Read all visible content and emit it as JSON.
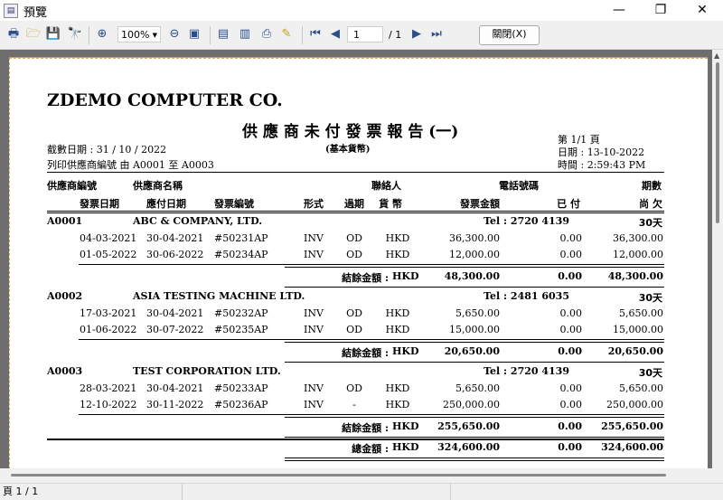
{
  "window": {
    "title": "預覽"
  },
  "toolbar": {
    "zoom": "100%",
    "page_current": "1",
    "page_total": "/ 1",
    "close_label": "關閉(X)"
  },
  "report": {
    "company": "ZDEMO COMPUTER CO.",
    "title": "供 應 商 未 付 發 票 報 告 (一)",
    "subtitle": "(基本貨幣)",
    "cutoff_date": "截數日期 :  31 / 10 / 2022",
    "range": "列印供應商編號 由    A0001  至   A0003",
    "page": "第 1/1 頁",
    "print_date": "日期 : 13-10-2022",
    "print_time": "時間 : 2:59:43 PM",
    "col": {
      "supplier_code": "供應商編號",
      "supplier_name": "供應商名稱",
      "contact": "聯絡人",
      "phone": "電話號碼",
      "terms": "期數",
      "inv_date": "發票日期",
      "due_date": "應付日期",
      "inv_no": "發票編號",
      "type": "形式",
      "overdue": "過期",
      "currency": "貨 幣",
      "amount": "發票金額",
      "paid": "已  付",
      "balance": "尚  欠"
    },
    "suppliers": [
      {
        "code": "A0001",
        "name": "ABC & COMPANY, LTD.",
        "tel": "Tel : 2720 4139",
        "terms": "30天",
        "rows": [
          [
            "04-03-2021",
            "30-04-2021",
            "#50231AP",
            "INV",
            "OD",
            "HKD",
            "36,300.00",
            "0.00",
            "36,300.00"
          ],
          [
            "01-05-2022",
            "30-06-2022",
            "#50234AP",
            "INV",
            "OD",
            "HKD",
            "12,000.00",
            "0.00",
            "12,000.00"
          ]
        ],
        "subtotal_label": "結餘金額 :",
        "subtotal_cur": "HKD",
        "subtotal": [
          "48,300.00",
          "0.00",
          "48,300.00"
        ]
      },
      {
        "code": "A0002",
        "name": "ASIA TESTING  MACHINE LTD.",
        "tel": "Tel : 2481 6035",
        "terms": "30天",
        "rows": [
          [
            "17-03-2021",
            "30-04-2021",
            "#50232AP",
            "INV",
            "OD",
            "HKD",
            "5,650.00",
            "0.00",
            "5,650.00"
          ],
          [
            "01-06-2022",
            "30-07-2022",
            "#50235AP",
            "INV",
            "OD",
            "HKD",
            "15,000.00",
            "0.00",
            "15,000.00"
          ]
        ],
        "subtotal_label": "結餘金額 :",
        "subtotal_cur": "HKD",
        "subtotal": [
          "20,650.00",
          "0.00",
          "20,650.00"
        ]
      },
      {
        "code": "A0003",
        "name": "TEST CORPORATION LTD.",
        "tel": "Tel : 2720 4139",
        "terms": "30天",
        "rows": [
          [
            "28-03-2021",
            "30-04-2021",
            "#50233AP",
            "INV",
            "OD",
            "HKD",
            "5,650.00",
            "0.00",
            "5,650.00"
          ],
          [
            "12-10-2022",
            "30-11-2022",
            "#50236AP",
            "INV",
            "-",
            "HKD",
            "250,000.00",
            "0.00",
            "250,000.00"
          ]
        ],
        "subtotal_label": "結餘金額 :",
        "subtotal_cur": "HKD",
        "subtotal": [
          "255,650.00",
          "0.00",
          "255,650.00"
        ]
      }
    ],
    "grand_label": "總金額 :",
    "grand_cur": "HKD",
    "grand": [
      "324,600.00",
      "0.00",
      "324,600.00"
    ]
  },
  "status": {
    "page": "頁 1 / 1"
  }
}
